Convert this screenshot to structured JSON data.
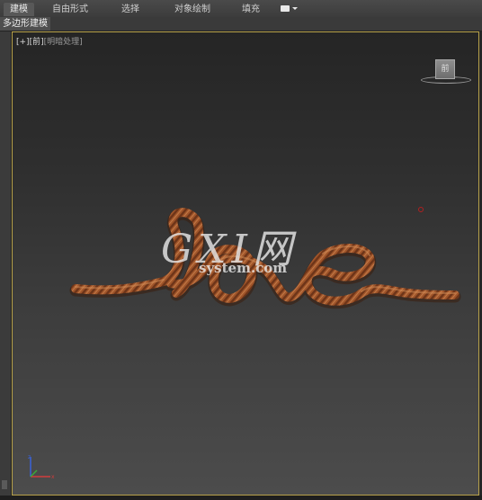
{
  "ribbon": {
    "tabs": [
      {
        "label": "建模",
        "active": true
      },
      {
        "label": "自由形式",
        "active": false
      },
      {
        "label": "选择",
        "active": false
      },
      {
        "label": "对象绘制",
        "active": false
      },
      {
        "label": "填充",
        "active": false
      }
    ],
    "dropdown_icon": "toggle-dropdown-icon"
  },
  "panel": {
    "label": "多边形建模"
  },
  "viewport": {
    "label_plus": "[+]",
    "label_view": "[前]",
    "label_shading": "[明暗处理]",
    "viewcube_face": "前",
    "object_description_icon": "rope-love-spline-object",
    "accent_color": "#b8a24a",
    "rope_color": "#a0552a"
  },
  "watermark": {
    "main": "GXI网",
    "sub": "system.com"
  },
  "axis_gizmo": {
    "icon": "xyz-axis-icon"
  }
}
